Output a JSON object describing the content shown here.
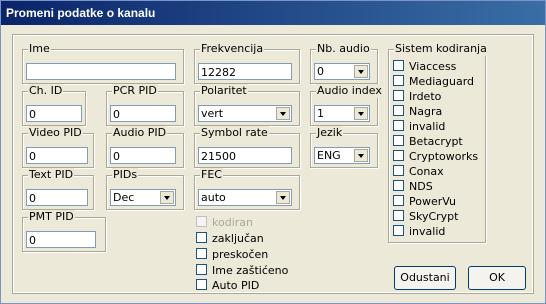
{
  "window": {
    "title": "Promeni podatke o kanalu"
  },
  "fields": {
    "ime": {
      "label": "Ime",
      "value": ""
    },
    "frekvencija": {
      "label": "Frekvencija",
      "value": "12282"
    },
    "nb_audio": {
      "label": "Nb. audio",
      "value": "0"
    },
    "ch_id": {
      "label": "Ch. ID",
      "value": "0"
    },
    "pcr_pid": {
      "label": "PCR PID",
      "value": "0"
    },
    "polaritet": {
      "label": "Polaritet",
      "value": "vert"
    },
    "audio_index": {
      "label": "Audio index",
      "value": "1"
    },
    "video_pid": {
      "label": "Video PID",
      "value": "0"
    },
    "audio_pid": {
      "label": "Audio PID",
      "value": "0"
    },
    "symbol_rate": {
      "label": "Symbol rate",
      "value": "21500"
    },
    "jezik": {
      "label": "Jezik",
      "value": "ENG"
    },
    "text_pid": {
      "label": "Text PID",
      "value": "0"
    },
    "pids": {
      "label": "PIDs",
      "value": "Dec"
    },
    "fec": {
      "label": "FEC",
      "value": "auto"
    },
    "pmt_pid": {
      "label": "PMT PID",
      "value": "0"
    }
  },
  "flags": [
    {
      "label": "kodiran",
      "disabled": true
    },
    {
      "label": "zaključan",
      "disabled": false
    },
    {
      "label": "preskočen",
      "disabled": false
    },
    {
      "label": "Ime zaštićeno",
      "disabled": false
    },
    {
      "label": "Auto PID",
      "disabled": false
    }
  ],
  "encryption": {
    "label": "Sistem kodiranja",
    "items": [
      "Viaccess",
      "Mediaguard",
      "Irdeto",
      "Nagra",
      "invalid",
      "Betacrypt",
      "Cryptoworks",
      "Conax",
      "NDS",
      "PowerVu",
      "SkyCrypt",
      "invalid"
    ]
  },
  "buttons": {
    "cancel": "Odustani",
    "ok": "OK"
  }
}
